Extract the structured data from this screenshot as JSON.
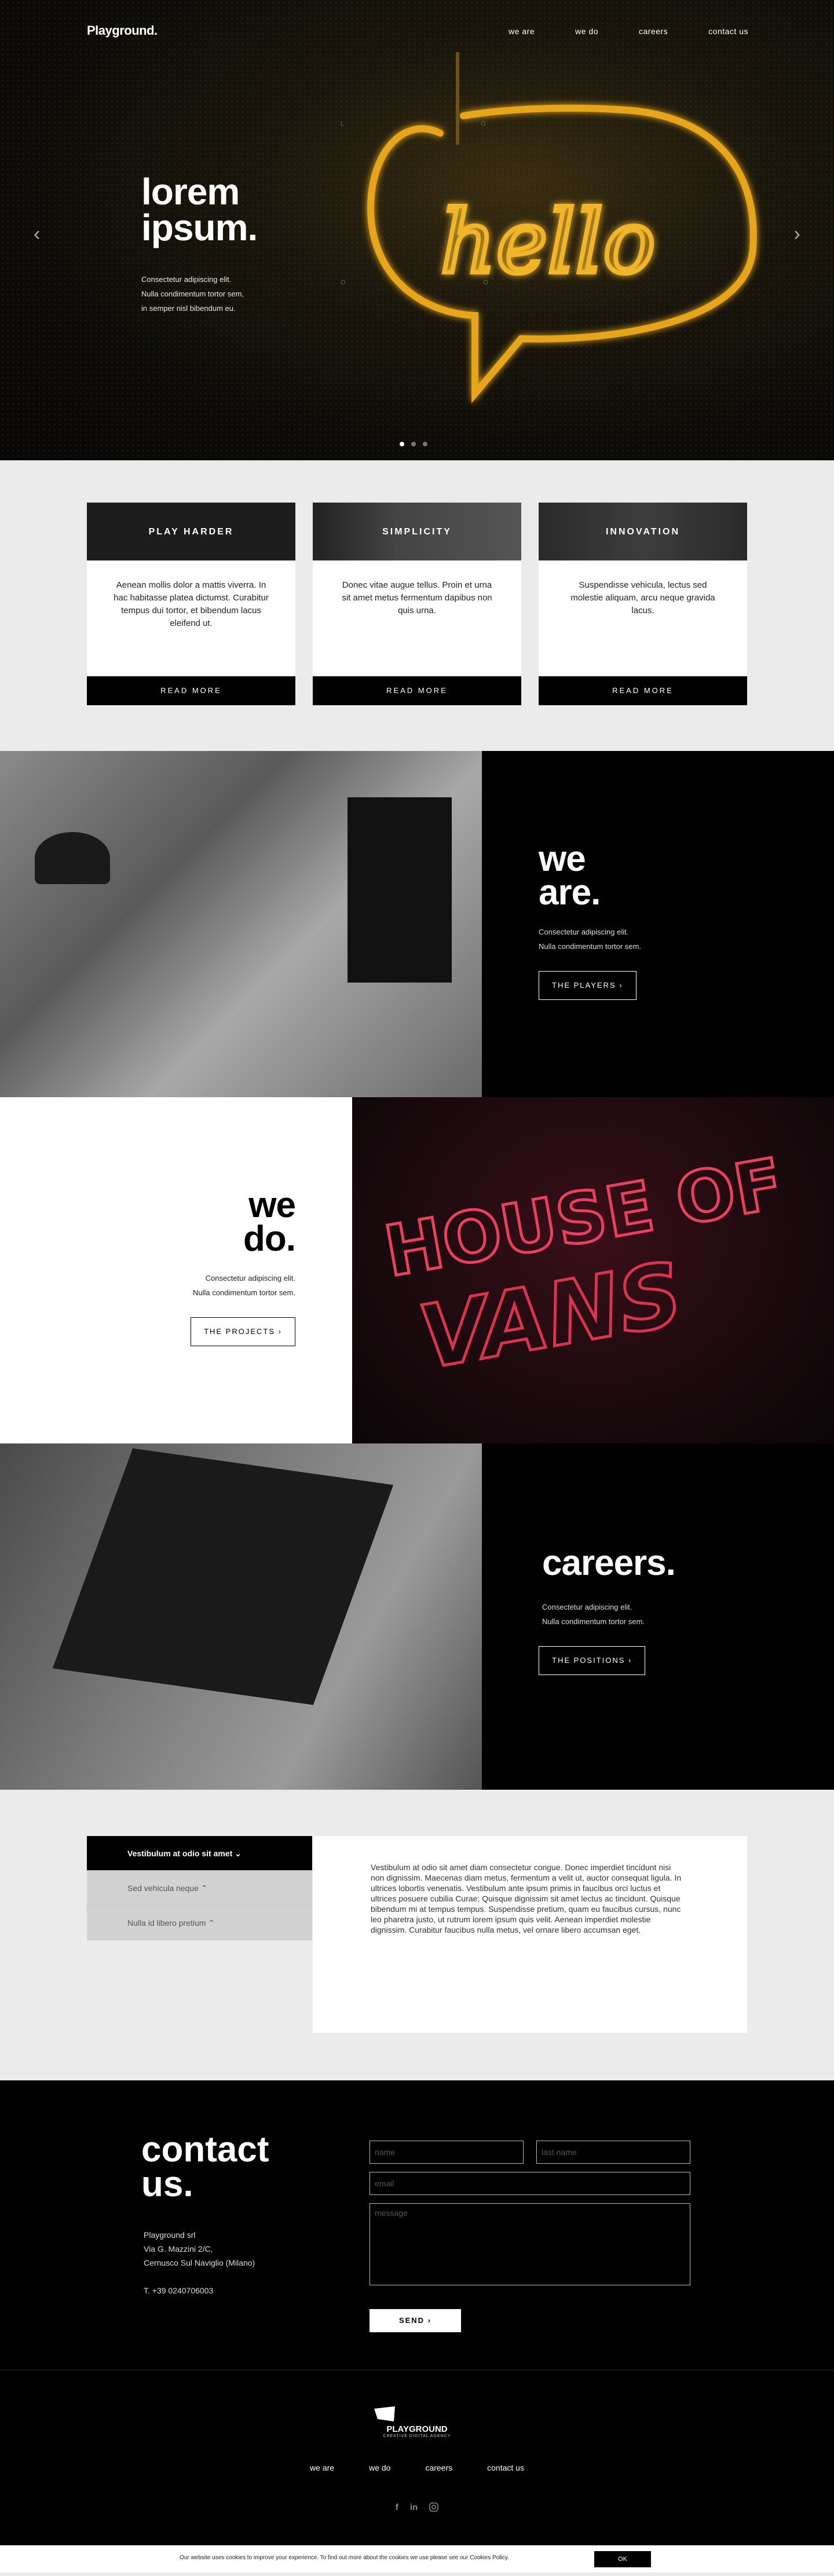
{
  "nav": {
    "logo": "Playground.",
    "links": [
      "we are",
      "we do",
      "careers",
      "contact us"
    ]
  },
  "hero": {
    "title_line1": "lorem",
    "title_line2": "ipsum.",
    "sub_line1": "Consectetur adipiscing elit.",
    "sub_line2": "Nulla condimentum tortor sem,",
    "sub_line3": "in semper nisl bibendum eu.",
    "slide_count": 3,
    "active_slide": 1
  },
  "features": [
    {
      "title": "PLAY HARDER",
      "text": "Aenean mollis dolor a mattis viverra. In hac habitasse platea dictumst. Curabitur tempus dui tortor, et bibendum lacus eleifend ut.",
      "button": "READ MORE"
    },
    {
      "title": "SIMPLICITY",
      "text": "Donec vitae augue tellus. Proin et urna sit amet metus fermentum dapibus non quis urna.",
      "button": "READ MORE"
    },
    {
      "title": "INNOVATION",
      "text": "Suspendisse vehicula, lectus sed molestie aliquam, arcu neque gravida lacus.",
      "button": "READ MORE"
    }
  ],
  "we_are": {
    "title_line1": "we",
    "title_line2": "are.",
    "sub_line1": "Consectetur adipiscing elit.",
    "sub_line2": "Nulla condimentum tortor sem.",
    "button": "THE PLAYERS"
  },
  "we_do": {
    "title_line1": "we",
    "title_line2": "do.",
    "sub_line1": "Consectetur adipiscing elit.",
    "sub_line2": "Nulla condimentum tortor sem.",
    "button": "THE PROJECTS"
  },
  "careers": {
    "title": "careers.",
    "sub_line1": "Consectetur adipiscing elit.",
    "sub_line2": "Nulla condimentum tortor sem.",
    "button": "THE POSITIONS"
  },
  "accordion": {
    "items": [
      "Vestibulum at odio sit amet",
      "Sed vehicula neque",
      "Nulla id libero pretium"
    ],
    "content": "Vestibulum at odio sit amet diam consectetur congue. Donec imperdiet tincidunt nisi non dignissim. Maecenas diam metus, fermentum a velit ut, auctor consequat ligula. In ultrices lobortis venenatis. Vestibulum ante ipsum primis in faucibus orci luctus et ultrices posuere cubilia Curae; Quisque dignissim sit amet lectus ac tincidunt. Quisque bibendum mi at tempus tempus. Suspendisse pretium, quam eu faucibus cursus, nunc leo pharetra justo, ut rutrum lorem ipsum quis velit. Aenean imperdiet molestie dignissim. Curabitur faucibus nulla metus, vel ornare libero accumsan eget."
  },
  "contact": {
    "title_line1": "contact",
    "title_line2": "us.",
    "address_line1": "Playground srl",
    "address_line2": "Via G. Mazzini 2/C,",
    "address_line3": "Cernusco Sul Naviglio (Milano)",
    "phone": "T. +39 0240706003",
    "name_placeholder": "name",
    "lastname_placeholder": "last name",
    "email_placeholder": "email",
    "message_placeholder": "message",
    "send": "SEND"
  },
  "footer": {
    "logo_name": "PLAYGROUND",
    "logo_tag": "CREATIVE DIGITAL AGENCY",
    "links": [
      "we are",
      "we do",
      "careers",
      "contact us"
    ],
    "social": [
      "facebook-icon",
      "linkedin-icon",
      "instagram-icon"
    ]
  },
  "cookie": {
    "text": "Our website uses cookies to improve your experience. To find out more about the cookies we use please see our Cookies Policy.",
    "ok": "OK"
  }
}
